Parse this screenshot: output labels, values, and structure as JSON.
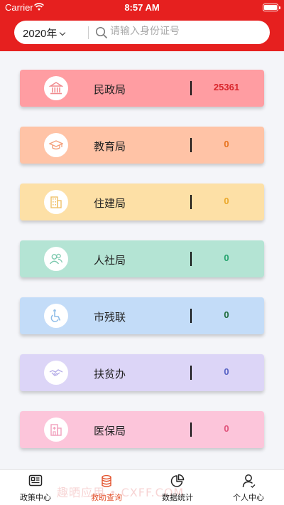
{
  "status_bar": {
    "carrier": "Carrier",
    "time": "8:57 AM"
  },
  "header": {
    "year_select": "2020年",
    "search_placeholder": "请输入身份证号"
  },
  "departments": [
    {
      "name": "民政局",
      "value": "25361",
      "bg": "#ff9da2",
      "value_color": "#d9262c",
      "icon": "bank-icon"
    },
    {
      "name": "教育局",
      "value": "0",
      "bg": "#ffc3a6",
      "value_color": "#e8741f",
      "icon": "graduation-cap-icon"
    },
    {
      "name": "住建局",
      "value": "0",
      "bg": "#fde0a6",
      "value_color": "#eba82a",
      "icon": "building-icon"
    },
    {
      "name": "人社局",
      "value": "0",
      "bg": "#b4e4d4",
      "value_color": "#24a36d",
      "icon": "people-icon"
    },
    {
      "name": "市残联",
      "value": "0",
      "bg": "#c3dcf8",
      "value_color": "#1d6b3b",
      "icon": "wheelchair-icon"
    },
    {
      "name": "扶贫办",
      "value": "0",
      "bg": "#dcd5f7",
      "value_color": "#5561c4",
      "icon": "handshake-icon"
    },
    {
      "name": "医保局",
      "value": "0",
      "bg": "#fcc5da",
      "value_color": "#e0527a",
      "icon": "hospital-icon"
    }
  ],
  "tabs": [
    {
      "label": "政策中心",
      "icon": "policy-icon",
      "active": false
    },
    {
      "label": "救助查询",
      "icon": "coins-icon",
      "active": true
    },
    {
      "label": "数据统计",
      "icon": "pie-chart-icon",
      "active": false
    },
    {
      "label": "个人中心",
      "icon": "user-icon",
      "active": false
    }
  ],
  "colors": {
    "header": "#e6201f",
    "active_tab": "#e3542f"
  },
  "watermark": "趣晒应用 • CXFF.COM"
}
